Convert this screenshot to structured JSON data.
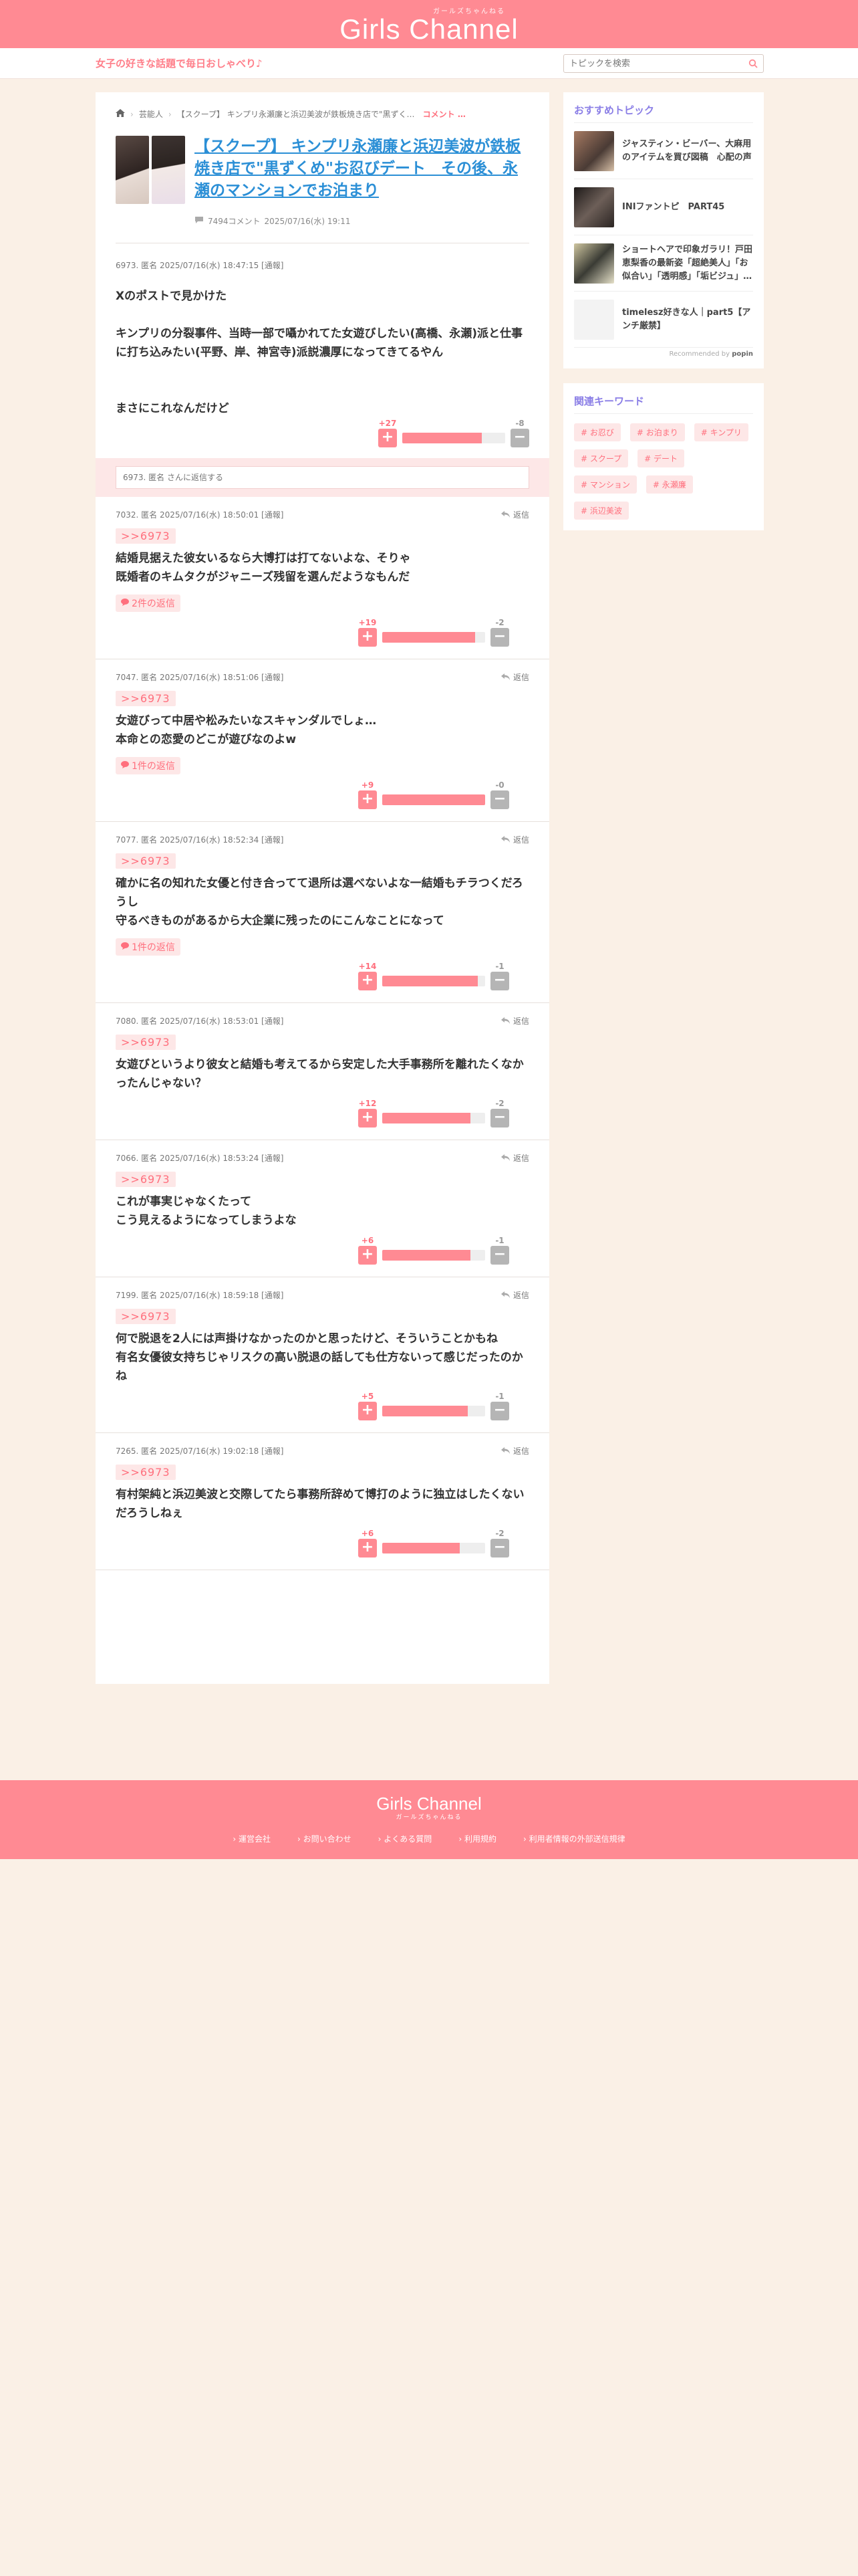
{
  "header": {
    "logo": "Girls Channel",
    "logo_kana": "ガールズちゃんねる"
  },
  "subbar": {
    "tagline": "女子の好きな話題で毎日おしゃべり♪",
    "search_placeholder": "トピックを検索"
  },
  "breadcrumb": {
    "home": "ホーム",
    "category": "芸能人",
    "current": "【スクープ】 キンプリ永瀬廉と浜辺美波が鉄板焼き店で\"黒ずくめ\"お忍びデ…",
    "comment_link": "コメント …"
  },
  "topic": {
    "title": "【スクープ】 キンプリ永瀬廉と浜辺美波が鉄板焼き店で\"黒ずくめ\"お忍びデート　その後、永瀬のマンションでお泊まり",
    "comments": "7494コメント",
    "date": "2025/07/16(水) 19:11"
  },
  "main_post": {
    "meta": "6973. 匿名 2025/07/16(水) 18:47:15 [通報]",
    "lines": [
      "Xのポストで見かけた",
      "",
      "キンプリの分裂事件、当時一部で囁かれてた女遊びしたい(高橋、永瀬)派と仕事に打ち込みたい(平野、岸、神宮寺)派説濃厚になってきてるやん",
      "",
      "",
      "まさにこれなんだけど"
    ],
    "plus": "+27",
    "minus": "-8",
    "ratio": 77
  },
  "reply_box": {
    "placeholder": "6973. 匿名 さんに返信する"
  },
  "reply_label": "返信",
  "comments": [
    {
      "meta": "7032. 匿名 2025/07/16(水) 18:50:01 [通報]",
      "anchor": ">>6973",
      "lines": [
        "結婚見据えた彼女いるなら大博打は打てないよな、そりゃ",
        "既婚者のキムタクがジャニーズ残留を選んだようなもんだ"
      ],
      "replies": "2件の返信",
      "plus": "+19",
      "minus": "-2",
      "ratio": 90
    },
    {
      "meta": "7047. 匿名 2025/07/16(水) 18:51:06 [通報]",
      "anchor": ">>6973",
      "lines": [
        "女遊びって中居や松みたいなスキャンダルでしょ…",
        "本命との恋愛のどこが遊びなのよw"
      ],
      "replies": "1件の返信",
      "plus": "+9",
      "minus": "-0",
      "ratio": 100
    },
    {
      "meta": "7077. 匿名 2025/07/16(水) 18:52:34 [通報]",
      "anchor": ">>6973",
      "lines": [
        "確かに名の知れた女優と付き合ってて退所は選べないよな一結婚もチラつくだろうし",
        "守るべきものがあるから大企業に残ったのにこんなことになって"
      ],
      "replies": "1件の返信",
      "plus": "+14",
      "minus": "-1",
      "ratio": 93
    },
    {
      "meta": "7080. 匿名 2025/07/16(水) 18:53:01 [通報]",
      "anchor": ">>6973",
      "lines": [
        "女遊びというより彼女と結婚も考えてるから安定した大手事務所を離れたくなかったんじゃない？"
      ],
      "replies": "",
      "plus": "+12",
      "minus": "-2",
      "ratio": 86
    },
    {
      "meta": "7066. 匿名 2025/07/16(水) 18:53:24 [通報]",
      "anchor": ">>6973",
      "lines": [
        "これが事実じゃなくたって",
        "こう見えるようになってしまうよな"
      ],
      "replies": "",
      "plus": "+6",
      "minus": "-1",
      "ratio": 86
    },
    {
      "meta": "7199. 匿名 2025/07/16(水) 18:59:18 [通報]",
      "anchor": ">>6973",
      "lines": [
        "何で脱退を2人には声掛けなかったのかと思ったけど、そういうことかもね",
        "有名女優彼女持ちじゃリスクの高い脱退の話しても仕方ないって感じだったのかね"
      ],
      "replies": "",
      "plus": "+5",
      "minus": "-1",
      "ratio": 83
    },
    {
      "meta": "7265. 匿名 2025/07/16(水) 19:02:18 [通報]",
      "anchor": ">>6973",
      "lines": [
        "有村架純と浜辺美波と交際してたら事務所辞めて博打のように独立はしたくないだろうしねぇ"
      ],
      "replies": "",
      "plus": "+6",
      "minus": "-2",
      "ratio": 75
    }
  ],
  "sidebar": {
    "rec_title": "おすすめトピック",
    "recommended": [
      {
        "title": "ジャスティン・ビーバー、大麻用のアイテムを買び図稿　心配の声"
      },
      {
        "title": "INIファントピ　PART45"
      },
      {
        "title": "ショートヘアで印象ガラリ！戸田恵梨香の最新姿「超絶美人」「お似合い」「透明感」「垢ビジュ」…"
      },
      {
        "title": "timelesz好きな人｜part5【アンチ厳禁】"
      }
    ],
    "rec_footer": "Recommended by",
    "rec_brand": "popin",
    "kw_title": "関連キーワード",
    "keywords": [
      "# お忍び",
      "# お泊まり",
      "# キンプリ",
      "# スクープ",
      "# デート",
      "# マンション",
      "# 永瀬廉",
      "# 浜辺美波"
    ]
  },
  "footer": {
    "logo": "Girls Channel",
    "logo_kana": "ガールズちゃんねる",
    "links": [
      "運営会社",
      "お問い合わせ",
      "よくある質問",
      "利用規約",
      "利用者情報の外部送信規律"
    ]
  }
}
